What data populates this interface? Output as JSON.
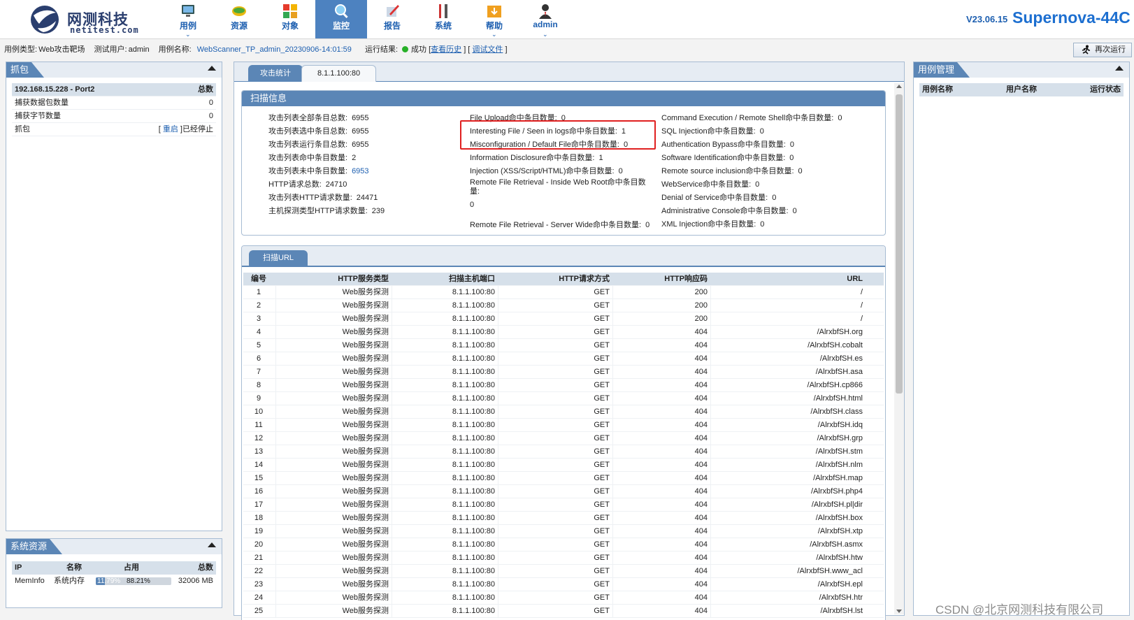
{
  "brand": {
    "name": "网测科技",
    "domain": "netitest.com",
    "version": "V23.06.15",
    "product": "Supernova-44C"
  },
  "nav": [
    {
      "label": "用例",
      "icon": "monitor-icon",
      "caret": true
    },
    {
      "label": "资源",
      "icon": "disc-icon",
      "caret": false
    },
    {
      "label": "对象",
      "icon": "grid-icon",
      "caret": false
    },
    {
      "label": "监控",
      "icon": "magnifier-icon",
      "caret": false,
      "active": true
    },
    {
      "label": "报告",
      "icon": "report-pen-icon",
      "caret": false
    },
    {
      "label": "系统",
      "icon": "tools-icon",
      "caret": false
    },
    {
      "label": "帮助",
      "icon": "folder-download-icon",
      "caret": true
    },
    {
      "label": "admin",
      "icon": "user-icon",
      "caret": true
    }
  ],
  "infobar": {
    "type_label": "用例类型:",
    "type_value": "Web攻击靶场",
    "user_label": "测试用户:",
    "user_value": "admin",
    "name_label": "用例名称:",
    "name_value": "WebScanner_TP_admin_20230906-14:01:59",
    "result_label": "运行结果:",
    "result_value": "成功",
    "history_link": "查看历史",
    "debug_link": "调试文件",
    "rerun_label": "再次运行"
  },
  "capture": {
    "title": "抓包",
    "header": {
      "name": "192.168.15.228 - Port2",
      "total": "总数"
    },
    "rows": [
      {
        "name": "捕获数据包数量",
        "value": "0"
      },
      {
        "name": "捕获字节数量",
        "value": "0"
      }
    ],
    "capture_label": "抓包",
    "restart_link": "重启",
    "stopped_text": "已经停止"
  },
  "sysres": {
    "title": "系统资源",
    "headers": [
      "IP",
      "名称",
      "占用",
      "总数"
    ],
    "row": {
      "ip": "MemInfo",
      "name": "系统内存",
      "bar1": "11.79%",
      "bar1_value": 11.79,
      "bar2": "88.21%",
      "total": "32006 MB"
    }
  },
  "tabs": [
    "攻击统计",
    "8.1.1.100:80"
  ],
  "scan_info": {
    "title": "扫描信息",
    "col1": [
      {
        "label": "攻击列表全部条目总数:",
        "value": "6955"
      },
      {
        "label": "攻击列表选中条目总数:",
        "value": "6955"
      },
      {
        "label": "攻击列表运行条目总数:",
        "value": "6955"
      },
      {
        "label": "攻击列表命中条目数量:",
        "value": "2"
      },
      {
        "label": "攻击列表未中条目数量:",
        "value": "6953"
      },
      {
        "label": "HTTP请求总数:",
        "value": "24710"
      },
      {
        "label": "攻击列表HTTP请求数量:",
        "value": "24471"
      },
      {
        "label": "主机探测类型HTTP请求数量:",
        "value": "239"
      }
    ],
    "col2": [
      {
        "label": "File Upload命中条目数量:",
        "value": "0"
      },
      {
        "label": "Interesting File / Seen in logs命中条目数量:",
        "value": "1"
      },
      {
        "label": "Misconfiguration / Default File命中条目数量:",
        "value": "0"
      },
      {
        "label": "Information Disclosure命中条目数量:",
        "value": "1"
      },
      {
        "label": "Injection (XSS/Script/HTML)命中条目数量:",
        "value": "0"
      },
      {
        "label": "Remote File Retrieval - Inside Web Root命中条目数",
        "label2": "量:",
        "value": "0"
      },
      {
        "label": "Remote File Retrieval - Server Wide命中条目数量:",
        "value": "0"
      }
    ],
    "col3": [
      {
        "label": "Command Execution / Remote Shell命中条目数量:",
        "value": "0"
      },
      {
        "label": "SQL Injection命中条目数量:",
        "value": "0"
      },
      {
        "label": "Authentication Bypass命中条目数量:",
        "value": "0"
      },
      {
        "label": "Software Identification命中条目数量:",
        "value": "0"
      },
      {
        "label": "Remote source inclusion命中条目数量:",
        "value": "0"
      },
      {
        "label": "WebService命中条目数量:",
        "value": "0"
      },
      {
        "label": "Denial of Service命中条目数量:",
        "value": "0"
      },
      {
        "label": "Administrative Console命中条目数量:",
        "value": "0"
      },
      {
        "label": "XML Injection命中条目数量:",
        "value": "0"
      }
    ]
  },
  "url_scan": {
    "tab": "扫描URL",
    "headers": [
      "编号",
      "HTTP服务类型",
      "扫描主机端口",
      "HTTP请求方式",
      "HTTP响应码",
      "URL"
    ],
    "rows": [
      [
        "1",
        "Web服务探测",
        "8.1.1.100:80",
        "GET",
        "200",
        "/"
      ],
      [
        "2",
        "Web服务探测",
        "8.1.1.100:80",
        "GET",
        "200",
        "/"
      ],
      [
        "3",
        "Web服务探测",
        "8.1.1.100:80",
        "GET",
        "200",
        "/"
      ],
      [
        "4",
        "Web服务探测",
        "8.1.1.100:80",
        "GET",
        "404",
        "/AlrxbfSH.org"
      ],
      [
        "5",
        "Web服务探测",
        "8.1.1.100:80",
        "GET",
        "404",
        "/AlrxbfSH.cobalt"
      ],
      [
        "6",
        "Web服务探测",
        "8.1.1.100:80",
        "GET",
        "404",
        "/AlrxbfSH.es"
      ],
      [
        "7",
        "Web服务探测",
        "8.1.1.100:80",
        "GET",
        "404",
        "/AlrxbfSH.asa"
      ],
      [
        "8",
        "Web服务探测",
        "8.1.1.100:80",
        "GET",
        "404",
        "/AlrxbfSH.cp866"
      ],
      [
        "9",
        "Web服务探测",
        "8.1.1.100:80",
        "GET",
        "404",
        "/AlrxbfSH.html"
      ],
      [
        "10",
        "Web服务探测",
        "8.1.1.100:80",
        "GET",
        "404",
        "/AlrxbfSH.class"
      ],
      [
        "11",
        "Web服务探测",
        "8.1.1.100:80",
        "GET",
        "404",
        "/AlrxbfSH.idq"
      ],
      [
        "12",
        "Web服务探测",
        "8.1.1.100:80",
        "GET",
        "404",
        "/AlrxbfSH.grp"
      ],
      [
        "13",
        "Web服务探测",
        "8.1.1.100:80",
        "GET",
        "404",
        "/AlrxbfSH.stm"
      ],
      [
        "14",
        "Web服务探测",
        "8.1.1.100:80",
        "GET",
        "404",
        "/AlrxbfSH.nlm"
      ],
      [
        "15",
        "Web服务探测",
        "8.1.1.100:80",
        "GET",
        "404",
        "/AlrxbfSH.map"
      ],
      [
        "16",
        "Web服务探测",
        "8.1.1.100:80",
        "GET",
        "404",
        "/AlrxbfSH.php4"
      ],
      [
        "17",
        "Web服务探测",
        "8.1.1.100:80",
        "GET",
        "404",
        "/AlrxbfSH.pl|dir"
      ],
      [
        "18",
        "Web服务探测",
        "8.1.1.100:80",
        "GET",
        "404",
        "/AlrxbfSH.box"
      ],
      [
        "19",
        "Web服务探测",
        "8.1.1.100:80",
        "GET",
        "404",
        "/AlrxbfSH.xtp"
      ],
      [
        "20",
        "Web服务探测",
        "8.1.1.100:80",
        "GET",
        "404",
        "/AlrxbfSH.asmx"
      ],
      [
        "21",
        "Web服务探测",
        "8.1.1.100:80",
        "GET",
        "404",
        "/AlrxbfSH.htw"
      ],
      [
        "22",
        "Web服务探测",
        "8.1.1.100:80",
        "GET",
        "404",
        "/AlrxbfSH.www_acl"
      ],
      [
        "23",
        "Web服务探测",
        "8.1.1.100:80",
        "GET",
        "404",
        "/AlrxbfSH.epl"
      ],
      [
        "24",
        "Web服务探测",
        "8.1.1.100:80",
        "GET",
        "404",
        "/AlrxbfSH.htr"
      ],
      [
        "25",
        "Web服务探测",
        "8.1.1.100:80",
        "GET",
        "404",
        "/AlrxbfSH.lst"
      ]
    ]
  },
  "case_mgmt": {
    "title": "用例管理",
    "headers": [
      "用例名称",
      "用户名称",
      "运行状态"
    ]
  },
  "watermark": "CSDN @北京网测科技有限公司",
  "colors": {
    "accent": "#5b86b6",
    "nav_active": "#4d82c0",
    "brand_text": "#1d6fd0",
    "success": "#28b028",
    "highlight": "#e02020"
  }
}
